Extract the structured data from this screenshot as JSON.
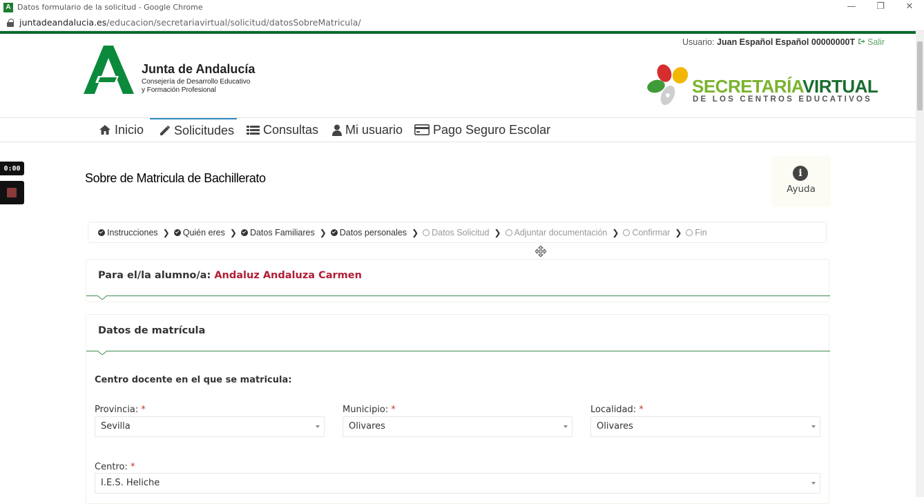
{
  "browser": {
    "window_title": "Datos formulario de la solicitud - Google Chrome",
    "url_host": "juntadeandalucia.es",
    "url_path": "/educacion/secretariavirtual/solicitud/datosSobreMatricula/",
    "minimize": "—",
    "restore": "❐",
    "close": "✕"
  },
  "header": {
    "user_label": "Usuario:",
    "user_name": "Juan Español Español 00000000T",
    "logout": "Salir",
    "junta_title": "Junta de Andalucía",
    "junta_sub1": "Consejería de Desarrollo Educativo",
    "junta_sub2": "y Formación Profesional",
    "sv_title_a": "SECRETARÍA",
    "sv_title_b": "VIRTUAL",
    "sv_sub": "DE LOS CENTROS EDUCATIVOS"
  },
  "nav": {
    "items": [
      {
        "label": "Inicio",
        "icon": "home-icon"
      },
      {
        "label": "Solicitudes",
        "icon": "pencil-icon",
        "active": true
      },
      {
        "label": "Consultas",
        "icon": "list-icon"
      },
      {
        "label": "Mi usuario",
        "icon": "user-icon"
      },
      {
        "label": "Pago Seguro Escolar",
        "icon": "credit-card-icon"
      }
    ]
  },
  "recorder": {
    "timer": "0:00"
  },
  "page": {
    "title": "Sobre de Matricula de Bachillerato",
    "help_label": "Ayuda"
  },
  "steps": [
    {
      "label": "Instrucciones",
      "done": true
    },
    {
      "label": "Quién eres",
      "done": true
    },
    {
      "label": "Datos Familiares",
      "done": true
    },
    {
      "label": "Datos personales",
      "done": true
    },
    {
      "label": "Datos Solicitud",
      "done": false
    },
    {
      "label": "Adjuntar documentación",
      "done": false
    },
    {
      "label": "Confirmar",
      "done": false
    },
    {
      "label": "Fin",
      "done": false
    }
  ],
  "student_panel": {
    "label": "Para el/la alumno/a:",
    "name": "Andaluz Andaluza Carmen"
  },
  "matricula_panel": {
    "title": "Datos de matrícula",
    "section": "Centro docente en el que se matricula:",
    "fields": {
      "provincia": {
        "label": "Provincia:",
        "value": "Sevilla"
      },
      "municipio": {
        "label": "Municipio:",
        "value": "Olivares"
      },
      "localidad": {
        "label": "Localidad:",
        "value": "Olivares"
      },
      "centro": {
        "label": "Centro:",
        "value": "I.E.S. Heliche"
      }
    },
    "required_mark": "*"
  },
  "colors": {
    "brand_green": "#0a6b2d",
    "panel_line": "#3d8b4c",
    "student_name": "#b01e35",
    "active_tab": "#2e8dbf",
    "sv_light_green": "#7ab32e"
  }
}
